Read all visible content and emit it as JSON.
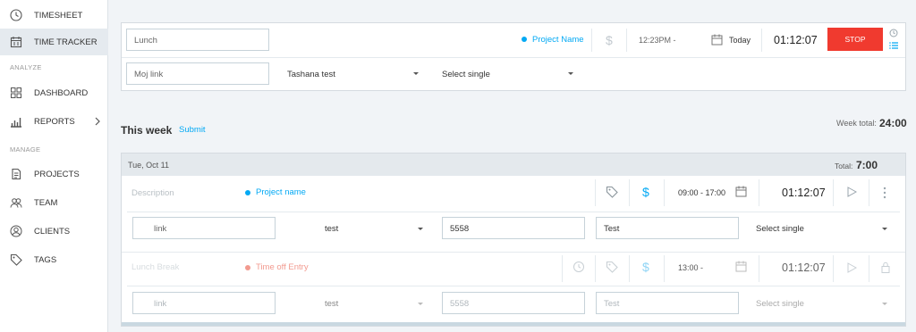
{
  "sidebar": {
    "items": [
      {
        "label": "TIMESHEET",
        "icon": "clock-icon"
      },
      {
        "label": "TIME TRACKER",
        "icon": "calendar-icon"
      },
      {
        "label": "DASHBOARD",
        "icon": "grid-icon"
      },
      {
        "label": "REPORTS",
        "icon": "bar-chart-icon"
      },
      {
        "label": "PROJECTS",
        "icon": "document-icon"
      },
      {
        "label": "TEAM",
        "icon": "team-icon"
      },
      {
        "label": "CLIENTS",
        "icon": "user-icon"
      },
      {
        "label": "TAGS",
        "icon": "tag-icon"
      }
    ],
    "sections": {
      "analyze": "ANALYZE",
      "manage": "MANAGE"
    }
  },
  "tracker": {
    "description": "Lunch",
    "project": "Project Name",
    "time_range": "12:23PM -",
    "date": "Today",
    "duration": "01:12:07",
    "stop_label": "STOP",
    "link_value": "Moj link",
    "select_one": "Tashana test",
    "select_two": "Select single"
  },
  "week": {
    "title": "This week",
    "submit": "Submit",
    "total_label": "Week total:",
    "total_value": "24:00"
  },
  "day": {
    "date": "Tue, Oct 11",
    "total_label": "Total:",
    "total_value": "7:00"
  },
  "entries": [
    {
      "description": "Description",
      "project": "Project name",
      "time_range": "09:00 - 17:00",
      "duration": "01:12:07",
      "link": "link",
      "select_one": "test",
      "field_one": "5558",
      "field_two": "Test",
      "select_two": "Select single"
    },
    {
      "description": "Lunch Break",
      "project": "Time off Entry",
      "time_range": "13:00 -",
      "duration": "01:12:07",
      "link": "link",
      "select_one": "test",
      "field_one": "5558",
      "field_two": "Test",
      "select_two": "Select single"
    }
  ],
  "colors": {
    "accent": "#03a9f4",
    "stop": "#f03a2f",
    "time_off": "#f29a8f"
  }
}
